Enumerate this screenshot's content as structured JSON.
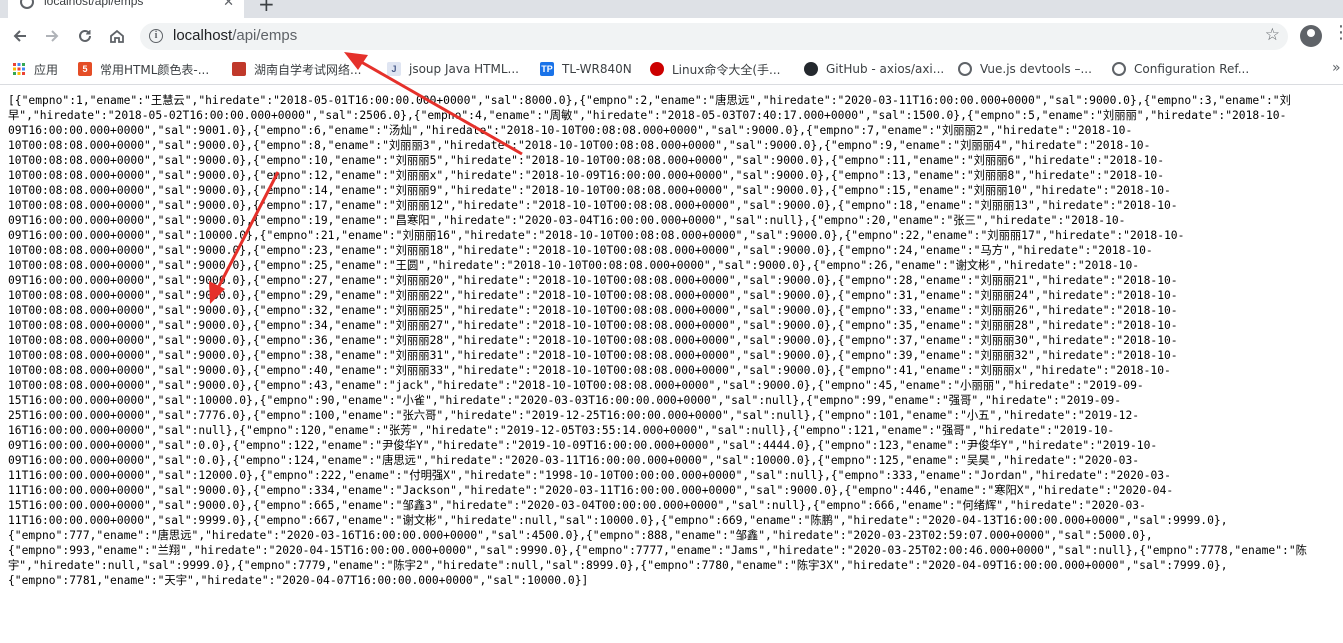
{
  "tab": {
    "title": "localhost/api/emps",
    "close_icon": "close-icon",
    "new_tab_icon": "plus-icon"
  },
  "toolbar": {
    "back_icon": "arrow-left-icon",
    "forward_icon": "arrow-right-icon",
    "reload_icon": "reload-icon",
    "home_icon": "home-icon"
  },
  "address": {
    "host": "localhost",
    "path": "/api/emps",
    "info_icon": "info-icon",
    "bookmark_icon": "star-icon"
  },
  "bookmarks": [
    {
      "label": "应用",
      "icon": "apps-grid-icon",
      "color": "#ea4335"
    },
    {
      "label": "常用HTML颜色表-...",
      "icon": "html5-icon",
      "color": "#e44d26"
    },
    {
      "label": "湖南自学考试网络...",
      "icon": "page-icon",
      "color": "#c0392b"
    },
    {
      "label": "jsoup Java HTML...",
      "icon": "jsoup-icon",
      "color": "#7a8bb5"
    },
    {
      "label": "TL-WR840N",
      "icon": "tplink-icon",
      "color": "#1a73e8"
    },
    {
      "label": "Linux命令大全(手...",
      "icon": "redhat-icon",
      "color": "#cc0000"
    },
    {
      "label": "GitHub - axios/axi...",
      "icon": "github-icon",
      "color": "#24292e"
    },
    {
      "label": "Vue.js devtools –...",
      "icon": "chrome-web-store-icon",
      "color": "#5f6368"
    },
    {
      "label": "Configuration Ref...",
      "icon": "chrome-web-store-icon",
      "color": "#5f6368"
    }
  ],
  "accent": {
    "annotation": "#e5312b"
  },
  "response_lines": [
    "[{\"empno\":1,\"ename\":\"王慧云\",\"hiredate\":\"2018-05-01T16:00:00.000+0000\",\"sal\":8000.0},{\"empno\":2,\"ename\":\"唐思远\",\"hiredate\":\"2020-03-11T16:00:00.000+0000\",\"sal\":9000.0},{\"empno\":3,\"ename\":\"刘",
    "早\",\"hiredate\":\"2018-05-02T16:00:00.000+0000\",\"sal\":2506.0},{\"empno\":4,\"ename\":\"周敏\",\"hiredate\":\"2018-05-03T07:40:17.000+0000\",\"sal\":1500.0},{\"empno\":5,\"ename\":\"刘丽丽\",\"hiredate\":\"2018-10-",
    "09T16:00:00.000+0000\",\"sal\":9001.0},{\"empno\":6,\"ename\":\"汤灿\",\"hiredate\":\"2018-10-10T00:08:08.000+0000\",\"sal\":9000.0},{\"empno\":7,\"ename\":\"刘丽丽2\",\"hiredate\":\"2018-10-",
    "10T00:08:08.000+0000\",\"sal\":9000.0},{\"empno\":8,\"ename\":\"刘丽丽3\",\"hiredate\":\"2018-10-10T00:08:08.000+0000\",\"sal\":9000.0},{\"empno\":9,\"ename\":\"刘丽丽4\",\"hiredate\":\"2018-10-",
    "10T00:08:08.000+0000\",\"sal\":9000.0},{\"empno\":10,\"ename\":\"刘丽丽5\",\"hiredate\":\"2018-10-10T00:08:08.000+0000\",\"sal\":9000.0},{\"empno\":11,\"ename\":\"刘丽丽6\",\"hiredate\":\"2018-10-",
    "10T00:08:08.000+0000\",\"sal\":9000.0},{\"empno\":12,\"ename\":\"刘丽丽x\",\"hiredate\":\"2018-10-09T16:00:00.000+0000\",\"sal\":9000.0},{\"empno\":13,\"ename\":\"刘丽丽8\",\"hiredate\":\"2018-10-",
    "10T00:08:08.000+0000\",\"sal\":9000.0},{\"empno\":14,\"ename\":\"刘丽丽9\",\"hiredate\":\"2018-10-10T00:08:08.000+0000\",\"sal\":9000.0},{\"empno\":15,\"ename\":\"刘丽丽10\",\"hiredate\":\"2018-10-",
    "10T00:08:08.000+0000\",\"sal\":9000.0},{\"empno\":17,\"ename\":\"刘丽丽12\",\"hiredate\":\"2018-10-10T00:08:08.000+0000\",\"sal\":9000.0},{\"empno\":18,\"ename\":\"刘丽丽13\",\"hiredate\":\"2018-10-",
    "09T16:00:00.000+0000\",\"sal\":9000.0},{\"empno\":19,\"ename\":\"昌寒阳\",\"hiredate\":\"2020-03-04T16:00:00.000+0000\",\"sal\":null},{\"empno\":20,\"ename\":\"张三\",\"hiredate\":\"2018-10-",
    "09T16:00:00.000+0000\",\"sal\":10000.0},{\"empno\":21,\"ename\":\"刘丽丽16\",\"hiredate\":\"2018-10-10T00:08:08.000+0000\",\"sal\":9000.0},{\"empno\":22,\"ename\":\"刘丽丽17\",\"hiredate\":\"2018-10-",
    "10T00:08:08.000+0000\",\"sal\":9000.0},{\"empno\":23,\"ename\":\"刘丽丽18\",\"hiredate\":\"2018-10-10T00:08:08.000+0000\",\"sal\":9000.0},{\"empno\":24,\"ename\":\"马方\",\"hiredate\":\"2018-10-",
    "10T00:08:08.000+0000\",\"sal\":9000.0},{\"empno\":25,\"ename\":\"王圆\",\"hiredate\":\"2018-10-10T00:08:08.000+0000\",\"sal\":9000.0},{\"empno\":26,\"ename\":\"谢文彬\",\"hiredate\":\"2018-10-",
    "09T16:00:00.000+0000\",\"sal\":9000.0},{\"empno\":27,\"ename\":\"刘丽丽20\",\"hiredate\":\"2018-10-10T00:08:08.000+0000\",\"sal\":9000.0},{\"empno\":28,\"ename\":\"刘丽丽21\",\"hiredate\":\"2018-10-",
    "10T00:08:08.000+0000\",\"sal\":9000.0},{\"empno\":29,\"ename\":\"刘丽丽22\",\"hiredate\":\"2018-10-10T00:08:08.000+0000\",\"sal\":9000.0},{\"empno\":31,\"ename\":\"刘丽丽24\",\"hiredate\":\"2018-10-",
    "10T00:08:08.000+0000\",\"sal\":9000.0},{\"empno\":32,\"ename\":\"刘丽丽25\",\"hiredate\":\"2018-10-10T00:08:08.000+0000\",\"sal\":9000.0},{\"empno\":33,\"ename\":\"刘丽丽26\",\"hiredate\":\"2018-10-",
    "10T00:08:08.000+0000\",\"sal\":9000.0},{\"empno\":34,\"ename\":\"刘丽丽27\",\"hiredate\":\"2018-10-10T00:08:08.000+0000\",\"sal\":9000.0},{\"empno\":35,\"ename\":\"刘丽丽28\",\"hiredate\":\"2018-10-",
    "10T00:08:08.000+0000\",\"sal\":9000.0},{\"empno\":36,\"ename\":\"刘丽丽28\",\"hiredate\":\"2018-10-10T00:08:08.000+0000\",\"sal\":9000.0},{\"empno\":37,\"ename\":\"刘丽丽30\",\"hiredate\":\"2018-10-",
    "10T00:08:08.000+0000\",\"sal\":9000.0},{\"empno\":38,\"ename\":\"刘丽丽31\",\"hiredate\":\"2018-10-10T00:08:08.000+0000\",\"sal\":9000.0},{\"empno\":39,\"ename\":\"刘丽丽32\",\"hiredate\":\"2018-10-",
    "10T00:08:08.000+0000\",\"sal\":9000.0},{\"empno\":40,\"ename\":\"刘丽丽33\",\"hiredate\":\"2018-10-10T00:08:08.000+0000\",\"sal\":9000.0},{\"empno\":41,\"ename\":\"刘丽丽x\",\"hiredate\":\"2018-10-",
    "10T00:08:08.000+0000\",\"sal\":9000.0},{\"empno\":43,\"ename\":\"jack\",\"hiredate\":\"2018-10-10T00:08:08.000+0000\",\"sal\":9000.0},{\"empno\":45,\"ename\":\"小丽丽\",\"hiredate\":\"2019-09-",
    "15T16:00:00.000+0000\",\"sal\":10000.0},{\"empno\":90,\"ename\":\"小雀\",\"hiredate\":\"2020-03-03T16:00:00.000+0000\",\"sal\":null},{\"empno\":99,\"ename\":\"强哥\",\"hiredate\":\"2019-09-",
    "25T16:00:00.000+0000\",\"sal\":7776.0},{\"empno\":100,\"ename\":\"张六哥\",\"hiredate\":\"2019-12-25T16:00:00.000+0000\",\"sal\":null},{\"empno\":101,\"ename\":\"小五\",\"hiredate\":\"2019-12-",
    "16T16:00:00.000+0000\",\"sal\":null},{\"empno\":120,\"ename\":\"张芳\",\"hiredate\":\"2019-12-05T03:55:14.000+0000\",\"sal\":null},{\"empno\":121,\"ename\":\"强哥\",\"hiredate\":\"2019-10-",
    "09T16:00:00.000+0000\",\"sal\":0.0},{\"empno\":122,\"ename\":\"尹俊华Y\",\"hiredate\":\"2019-10-09T16:00:00.000+0000\",\"sal\":4444.0},{\"empno\":123,\"ename\":\"尹俊华Y\",\"hiredate\":\"2019-10-",
    "09T16:00:00.000+0000\",\"sal\":0.0},{\"empno\":124,\"ename\":\"唐思远\",\"hiredate\":\"2020-03-11T16:00:00.000+0000\",\"sal\":10000.0},{\"empno\":125,\"ename\":\"吴昊\",\"hiredate\":\"2020-03-",
    "11T16:00:00.000+0000\",\"sal\":12000.0},{\"empno\":222,\"ename\":\"付明强X\",\"hiredate\":\"1998-10-10T00:00:00.000+0000\",\"sal\":null},{\"empno\":333,\"ename\":\"Jordan\",\"hiredate\":\"2020-03-",
    "11T16:00:00.000+0000\",\"sal\":9000.0},{\"empno\":334,\"ename\":\"Jackson\",\"hiredate\":\"2020-03-11T16:00:00.000+0000\",\"sal\":9000.0},{\"empno\":446,\"ename\":\"寒阳X\",\"hiredate\":\"2020-04-",
    "15T16:00:00.000+0000\",\"sal\":9000.0},{\"empno\":665,\"ename\":\"邹鑫3\",\"hiredate\":\"2020-03-04T00:00:00.000+0000\",\"sal\":null},{\"empno\":666,\"ename\":\"何绪辉\",\"hiredate\":\"2020-03-",
    "11T16:00:00.000+0000\",\"sal\":9999.0},{\"empno\":667,\"ename\":\"谢文彬\",\"hiredate\":null,\"sal\":10000.0},{\"empno\":669,\"ename\":\"陈鹏\",\"hiredate\":\"2020-04-13T16:00:00.000+0000\",\"sal\":9999.0},",
    "{\"empno\":777,\"ename\":\"唐思远\",\"hiredate\":\"2020-03-16T16:00:00.000+0000\",\"sal\":4500.0},{\"empno\":888,\"ename\":\"邹鑫\",\"hiredate\":\"2020-03-23T02:59:07.000+0000\",\"sal\":5000.0},",
    "{\"empno\":993,\"ename\":\"兰翔\",\"hiredate\":\"2020-04-15T16:00:00.000+0000\",\"sal\":9990.0},{\"empno\":7777,\"ename\":\"Jams\",\"hiredate\":\"2020-03-25T02:00:46.000+0000\",\"sal\":null},{\"empno\":7778,\"ename\":\"陈",
    "宇\",\"hiredate\":null,\"sal\":9999.0},{\"empno\":7779,\"ename\":\"陈宇2\",\"hiredate\":null,\"sal\":8999.0},{\"empno\":7780,\"ename\":\"陈宇3X\",\"hiredate\":\"2020-04-09T16:00:00.000+0000\",\"sal\":7999.0},",
    "{\"empno\":7781,\"ename\":\"天宇\",\"hiredate\":\"2020-04-07T16:00:00.000+0000\",\"sal\":10000.0}]"
  ]
}
